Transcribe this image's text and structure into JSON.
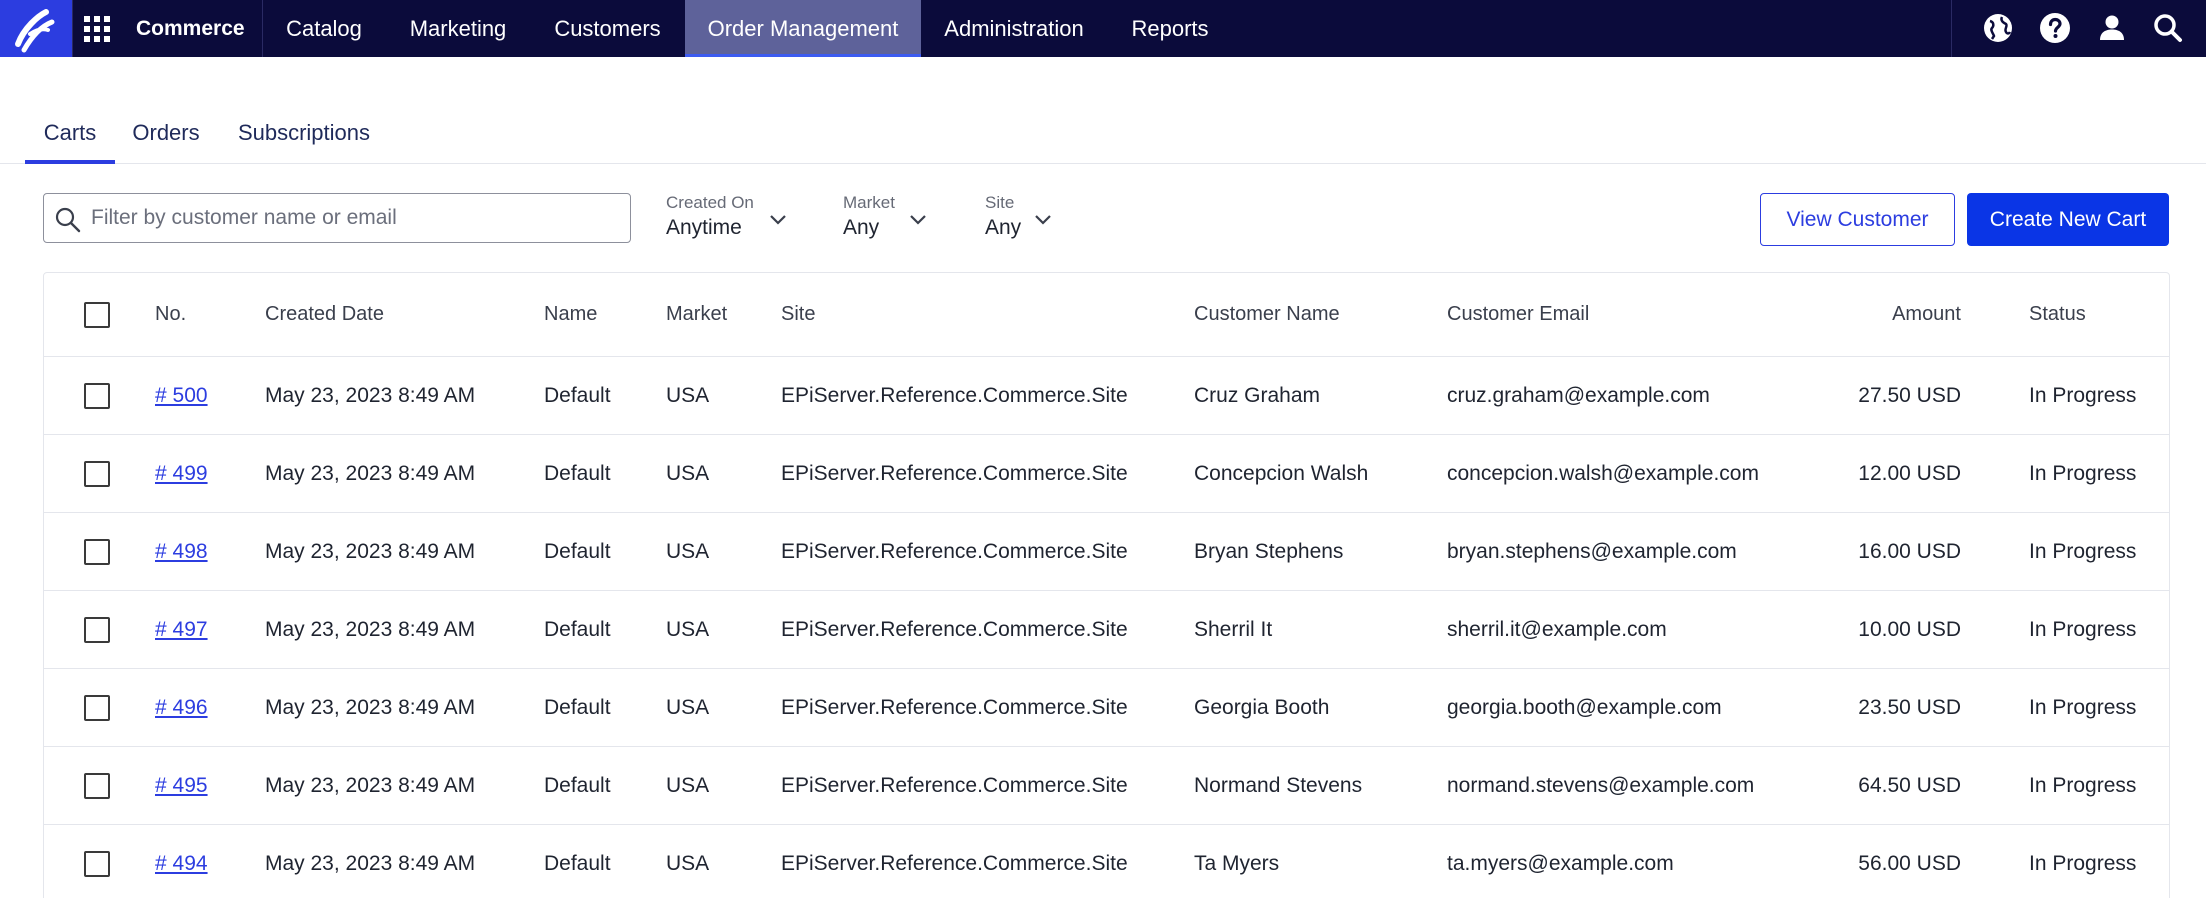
{
  "nav": {
    "brand": "Commerce",
    "items": [
      "Catalog",
      "Marketing",
      "Customers",
      "Order Management",
      "Administration",
      "Reports"
    ],
    "active": "Order Management"
  },
  "tabs": {
    "items": [
      "Carts",
      "Orders",
      "Subscriptions"
    ],
    "active": "Carts"
  },
  "filters": {
    "search_placeholder": "Filter by customer name or email",
    "created_on_label": "Created On",
    "created_on_value": "Anytime",
    "market_label": "Market",
    "market_value": "Any",
    "site_label": "Site",
    "site_value": "Any"
  },
  "actions": {
    "view_customer": "View Customer",
    "create_new_cart": "Create New Cart"
  },
  "table": {
    "columns": [
      "No.",
      "Created Date",
      "Name",
      "Market",
      "Site",
      "Customer Name",
      "Customer Email",
      "Amount",
      "Status"
    ],
    "rows": [
      {
        "no": "# 500",
        "created": "May 23, 2023 8:49 AM",
        "name": "Default",
        "market": "USA",
        "site": "EPiServer.Reference.Commerce.Site",
        "customer": "Cruz Graham",
        "email": "cruz.graham@example.com",
        "amount": "27.50 USD",
        "status": "In Progress"
      },
      {
        "no": "# 499",
        "created": "May 23, 2023 8:49 AM",
        "name": "Default",
        "market": "USA",
        "site": "EPiServer.Reference.Commerce.Site",
        "customer": "Concepcion Walsh",
        "email": "concepcion.walsh@example.com",
        "amount": "12.00 USD",
        "status": "In Progress"
      },
      {
        "no": "# 498",
        "created": "May 23, 2023 8:49 AM",
        "name": "Default",
        "market": "USA",
        "site": "EPiServer.Reference.Commerce.Site",
        "customer": "Bryan Stephens",
        "email": "bryan.stephens@example.com",
        "amount": "16.00 USD",
        "status": "In Progress"
      },
      {
        "no": "# 497",
        "created": "May 23, 2023 8:49 AM",
        "name": "Default",
        "market": "USA",
        "site": "EPiServer.Reference.Commerce.Site",
        "customer": "Sherril It",
        "email": "sherril.it@example.com",
        "amount": "10.00 USD",
        "status": "In Progress"
      },
      {
        "no": "# 496",
        "created": "May 23, 2023 8:49 AM",
        "name": "Default",
        "market": "USA",
        "site": "EPiServer.Reference.Commerce.Site",
        "customer": "Georgia Booth",
        "email": "georgia.booth@example.com",
        "amount": "23.50 USD",
        "status": "In Progress"
      },
      {
        "no": "# 495",
        "created": "May 23, 2023 8:49 AM",
        "name": "Default",
        "market": "USA",
        "site": "EPiServer.Reference.Commerce.Site",
        "customer": "Normand Stevens",
        "email": "normand.stevens@example.com",
        "amount": "64.50 USD",
        "status": "In Progress"
      },
      {
        "no": "# 494",
        "created": "May 23, 2023 8:49 AM",
        "name": "Default",
        "market": "USA",
        "site": "EPiServer.Reference.Commerce.Site",
        "customer": "Ta Myers",
        "email": "ta.myers@example.com",
        "amount": "56.00 USD",
        "status": "In Progress"
      }
    ]
  },
  "icons": {
    "logo": "commerce-logo-icon",
    "apps": "apps-grid-icon",
    "globe": "globe-icon",
    "help": "help-icon",
    "user": "user-icon",
    "search": "search-icon",
    "chevron": "chevron-down-icon",
    "checkbox": "checkbox-icon"
  },
  "colors": {
    "nav_bg": "#0b0b3b",
    "logo_bg": "#2c3de0",
    "active_nav_bg": "#5e629a",
    "accent": "#2c3de0",
    "primary_button": "#0a35e6"
  }
}
